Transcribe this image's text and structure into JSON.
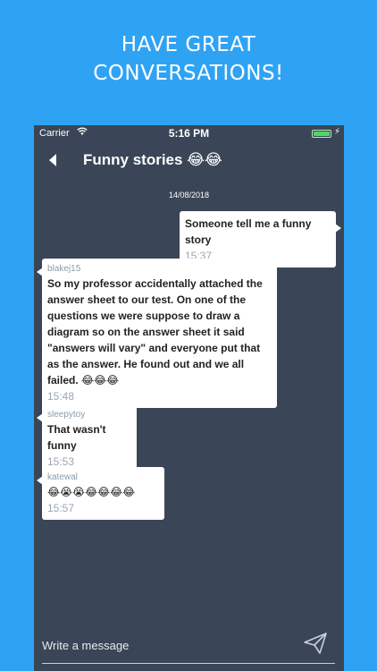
{
  "promo": {
    "line1": "HAVE GREAT",
    "line2": "CONVERSATIONS!"
  },
  "status_bar": {
    "carrier": "Carrier",
    "time": "5:16 PM"
  },
  "nav": {
    "title": "Funny stories 😂😂"
  },
  "chat": {
    "date": "14/08/2018",
    "messages": [
      {
        "side": "outgoing",
        "author": "",
        "text": "Someone tell me a funny story",
        "time": "15:37"
      },
      {
        "side": "incoming",
        "author": "blakej15",
        "text": "So my professor accidentally attached the answer sheet to our test. On one of the questions we were suppose to draw a diagram so on the answer sheet it said \"answers will vary\" and everyone put that as the answer. He found out and we all failed. 😂😂😂",
        "time": "15:48"
      },
      {
        "side": "incoming",
        "author": "sleepytoy",
        "text": "That wasn't funny",
        "time": "15:53"
      },
      {
        "side": "incoming",
        "author": "katewal",
        "text": "😂😭😭😂😂😂😂",
        "time": "15:57"
      }
    ]
  },
  "composer": {
    "placeholder": "Write a message"
  },
  "colors": {
    "background": "#2fa3f3",
    "chat_background": "#3a4657",
    "bubble": "#ffffff",
    "battery": "#4cd964"
  },
  "icons": {
    "back": "back-arrow-icon",
    "send": "send-paper-plane-icon",
    "wifi": "wifi-icon",
    "battery": "battery-icon"
  }
}
